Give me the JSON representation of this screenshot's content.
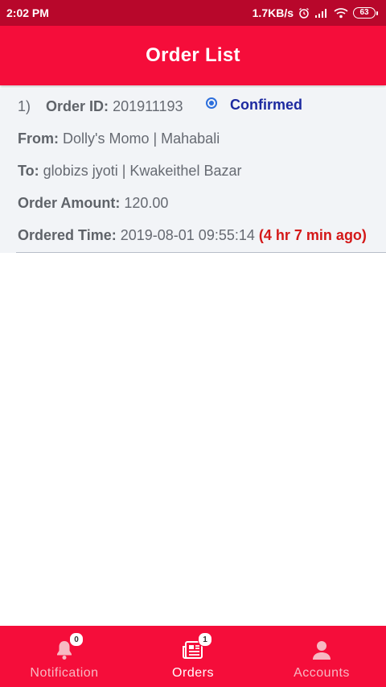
{
  "statusbar": {
    "time": "2:02 PM",
    "network_speed": "1.7KB/s",
    "battery": "63"
  },
  "appbar": {
    "title": "Order List"
  },
  "orders": [
    {
      "index": "1)",
      "order_id_label": "Order ID:",
      "order_id": "201911193",
      "status": "Confirmed",
      "from_label": "From:",
      "from": "Dolly's Momo | Mahabali",
      "to_label": "To:",
      "to": "globizs jyoti | Kwakeithel Bazar",
      "amount_label": "Order Amount:",
      "amount": "120.00",
      "time_label": "Ordered Time:",
      "time": "2019-08-01 09:55:14",
      "ago": "(4 hr 7 min ago)"
    }
  ],
  "bottomnav": {
    "items": [
      {
        "label": "Notification",
        "icon": "bell-icon",
        "badge": "0",
        "active": false
      },
      {
        "label": "Orders",
        "icon": "orders-icon",
        "badge": "1",
        "active": true
      },
      {
        "label": "Accounts",
        "icon": "person-icon",
        "active": false
      }
    ]
  },
  "colors": {
    "statusbar": "#b8072b",
    "primary": "#f50d3a",
    "status_confirmed": "#1d2aa0",
    "time_ago": "#d41818"
  }
}
